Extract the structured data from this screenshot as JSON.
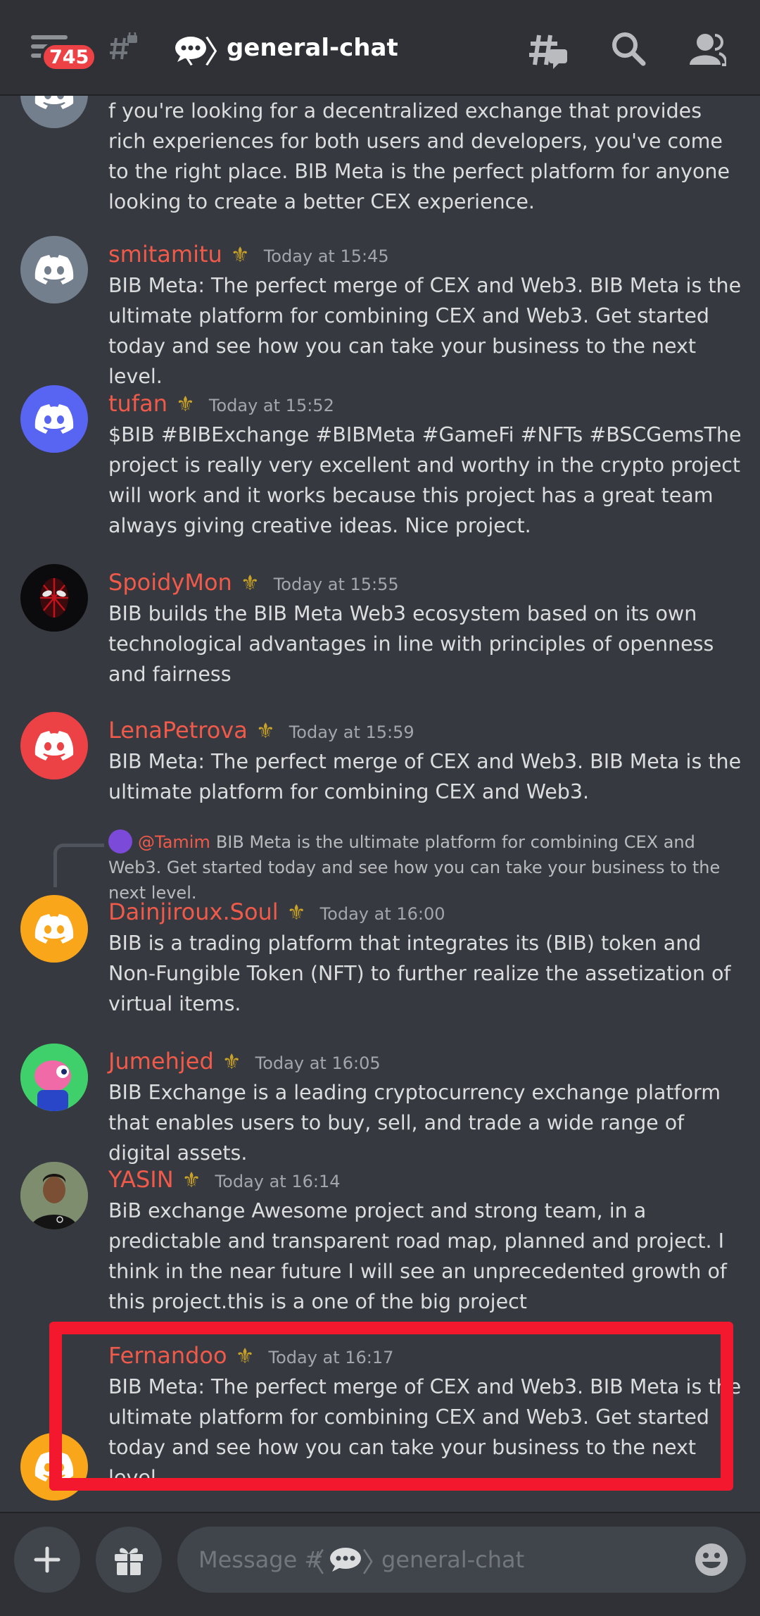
{
  "header": {
    "notification_count": "745",
    "channel_name": "general-chat"
  },
  "messages": [
    {
      "text": "f you're looking for a decentralized exchange that provides rich experiences for both users and developers, you've come to the right place. BIB Meta is the perfect platform for anyone looking to create a better CEX experience."
    },
    {
      "username": "smitamitu",
      "timestamp": "Today at 15:45",
      "text": "BIB Meta: The perfect merge of CEX and Web3. BIB Meta is the ultimate platform for combining CEX and Web3. Get started today and see how you can take your business to the next level."
    },
    {
      "username": "tufan",
      "timestamp": "Today at 15:52",
      "text": "$BIB #BIBExchange #BIBMeta #GameFi #NFTs #BSCGemsThe project is really very excellent and worthy in the crypto  project will work and it works because this project has a great team always giving creative ideas. Nice project."
    },
    {
      "username": "SpoidyMon",
      "timestamp": "Today at 15:55",
      "text": "BIB builds the BIB Meta Web3 ecosystem based on its own technological advantages in line with principles of openness and fairness"
    },
    {
      "username": "LenaPetrova",
      "timestamp": "Today at 15:59",
      "text": "BIB Meta: The perfect merge of CEX and Web3. BIB Meta is the ultimate platform for combining CEX and Web3."
    },
    {
      "reply_name": "@Tamim",
      "reply_text": "BIB Meta is the ultimate platform for combining CEX and Web3. Get started today and see how you can take your business to the next level.",
      "username": "Dainjiroux.Soul",
      "timestamp": "Today at 16:00",
      "text": "BIB  is  a trading  platform  that integrates its (BIB) token  and Non-Fungible Token (NFT)  to  further  realize  the  assetization  of virtual  items."
    },
    {
      "username": "Jumehjed",
      "timestamp": "Today at 16:05",
      "text": "BIB Exchange is a leading cryptocurrency exchange platform that enables users to buy, sell, and trade a wide range of digital assets."
    },
    {
      "username": "YASIN",
      "timestamp": "Today at 16:14",
      "text": "BiB exchange Awesome project and strong team, in a predictable and transparent road map, planned and project. I think in the near future I will see an unprecedented growth of this project.this is a one of the big project"
    },
    {
      "username": "Fernandoo",
      "timestamp": "Today at 16:17",
      "text": "BIB Meta: The perfect merge of CEX and Web3. BIB Meta is the ultimate platform for combining CEX and Web3. Get started today and see how you can take your business to the next level."
    }
  ],
  "composer": {
    "placeholder_prefix": "Message #",
    "placeholder_channel": "general-chat"
  },
  "icons": {
    "menu": "hamburger-icon",
    "channel_lock": "hashtag-lock-icon",
    "threads": "threads-icon",
    "search": "search-icon",
    "members": "members-icon",
    "add": "plus-icon",
    "gift": "gift-icon",
    "emoji": "emoji-icon"
  },
  "colors": {
    "background": "#36393f",
    "header": "#2f3136",
    "username": "#f05a4a",
    "badge": "#ed4245",
    "highlight": "#f4182e",
    "timestamp": "#a3a6aa"
  }
}
